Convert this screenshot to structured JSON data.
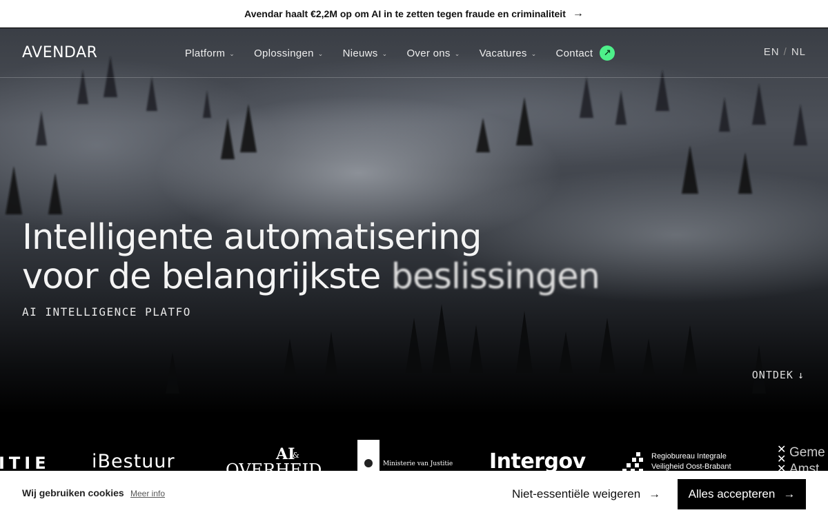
{
  "announcement": {
    "text": "Avendar haalt €2,2M op om AI in te zetten tegen fraude en criminaliteit",
    "arrow": "→"
  },
  "nav": {
    "logo": "AVENDAR",
    "items": [
      {
        "label": "Platform",
        "icon": "chevron-down-icon"
      },
      {
        "label": "Oplossingen",
        "icon": "chevron-down-icon"
      },
      {
        "label": "Nieuws",
        "icon": "chevron-down-icon"
      },
      {
        "label": "Over ons",
        "icon": "chevron-down-icon"
      },
      {
        "label": "Vacatures",
        "icon": "chevron-down-icon"
      }
    ],
    "contact": {
      "label": "Contact",
      "icon": "arrow-up-right-icon",
      "badge_color": "#4ef08a",
      "glyph": "↗"
    },
    "languages": [
      "EN",
      "NL"
    ],
    "language_separator": "/"
  },
  "hero": {
    "headline_line1": "Intelligente automatisering",
    "headline_line2_start": "voor de belangrijkste ",
    "headline_line2_end": "beslissingen",
    "tagline": "AI INTELLIGENCE PLATFO",
    "discover": "ONTDEK",
    "discover_arrow": "↓"
  },
  "partner_logos": [
    {
      "text": "ITIE"
    },
    {
      "text": "iBestuur"
    },
    {
      "text_top": "AI",
      "text_amp": "&",
      "text_bottom": "OVERHEID"
    },
    {
      "text": "Ministerie van Justitie"
    },
    {
      "text": "Intergov"
    },
    {
      "line1": "Regiobureau Integrale",
      "line2": "Veiligheid Oost-Brabant"
    },
    {
      "line1": "Geme",
      "line2": "Amst"
    }
  ],
  "cookie": {
    "title": "Wij gebruiken cookies",
    "more_info": "Meer info",
    "reject": "Niet-essentiële weigeren",
    "accept": "Alles accepteren",
    "arrow": "→"
  }
}
